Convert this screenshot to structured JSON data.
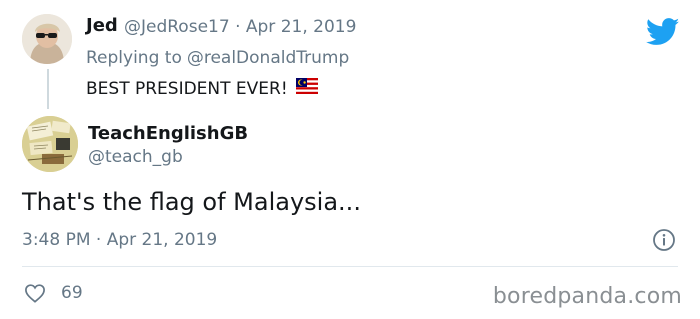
{
  "first_tweet": {
    "name": "Jed",
    "handle": "@JedRose17",
    "dot": "·",
    "date": "Apr 21, 2019",
    "reply_prefix": "Replying to",
    "reply_to": "@realDonaldTrump",
    "text": "BEST PRESIDENT EVER!",
    "flag_icon": "malaysia-flag-icon"
  },
  "main_tweet": {
    "name": "TeachEnglishGB",
    "handle": "@teach_gb",
    "text": "That's the flag of Malaysia...",
    "time": "3:48 PM",
    "dot": "·",
    "date": "Apr 21, 2019",
    "likes": "69"
  },
  "brand": {
    "twitter_color": "#1da1f2",
    "watermark": "boredpanda.com"
  }
}
